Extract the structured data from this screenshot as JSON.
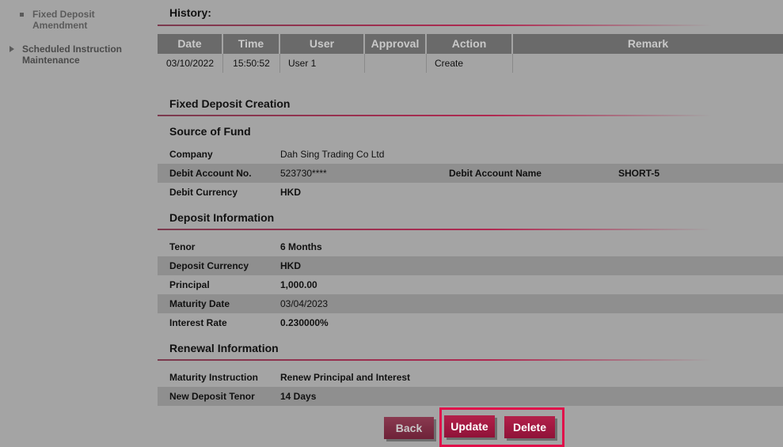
{
  "sidebar": {
    "sub_item": "Fixed Deposit Amendment",
    "main_item": "Scheduled Instruction Maintenance"
  },
  "history": {
    "title": "History:",
    "headers": [
      "Date",
      "Time",
      "User",
      "Approval",
      "Action",
      "Remark"
    ],
    "rows": [
      {
        "date": "03/10/2022",
        "time": "15:50:52",
        "user": "User 1",
        "approval": "",
        "action": "Create",
        "remark": ""
      }
    ]
  },
  "form": {
    "title": "Fixed Deposit Creation",
    "source": {
      "title": "Source of Fund",
      "company_label": "Company",
      "company_value": "Dah Sing Trading Co Ltd",
      "debit_no_label": "Debit Account No.",
      "debit_no_value": "523730****",
      "debit_name_label": "Debit Account Name",
      "debit_name_value": "SHORT-5",
      "currency_label": "Debit Currency",
      "currency_value": "HKD"
    },
    "deposit": {
      "title": "Deposit Information",
      "tenor_label": "Tenor",
      "tenor_value": "6 Months",
      "currency_label": "Deposit Currency",
      "currency_value": "HKD",
      "principal_label": "Principal",
      "principal_value": "1,000.00",
      "maturity_label": "Maturity Date",
      "maturity_value": "03/04/2023",
      "rate_label": "Interest Rate",
      "rate_value": "0.230000%"
    },
    "renewal": {
      "title": "Renewal Information",
      "instruction_label": "Maturity Instruction",
      "instruction_value": "Renew Principal and Interest",
      "tenor_label": "New Deposit Tenor",
      "tenor_value": "14 Days"
    }
  },
  "buttons": {
    "back": "Back",
    "update": "Update",
    "delete": "Delete"
  },
  "colors": {
    "accent": "#a0184a",
    "highlight": "#e0104a"
  }
}
